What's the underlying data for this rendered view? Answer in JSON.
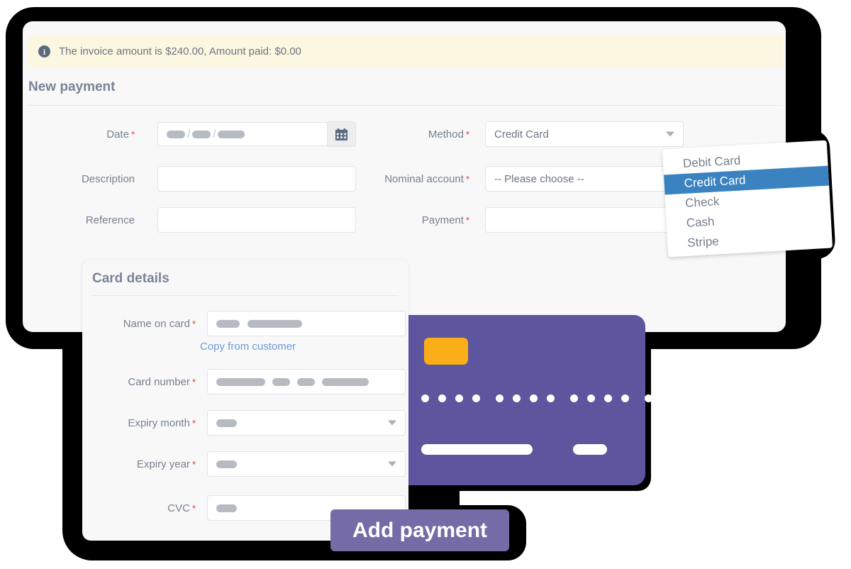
{
  "alert": {
    "icon": "info-icon",
    "text": "The invoice amount is $240.00, Amount paid: $0.00"
  },
  "main_form": {
    "title": "New payment",
    "left_fields": [
      {
        "label": "Date",
        "required": true,
        "value_masked": true,
        "mask_pattern": "dd/mm/yyyy",
        "trailing_icon": "calendar-icon"
      },
      {
        "label": "Description",
        "required": false,
        "value": ""
      },
      {
        "label": "Reference",
        "required": false,
        "value": ""
      }
    ],
    "right_fields": [
      {
        "label": "Method",
        "required": true,
        "value": "Credit Card",
        "type": "select"
      },
      {
        "label": "Nominal account",
        "required": true,
        "value": "-- Please choose --",
        "type": "select"
      },
      {
        "label": "Payment",
        "required": true,
        "value": "",
        "type": "text"
      }
    ]
  },
  "method_dropdown": {
    "options": [
      {
        "label": "Debit Card",
        "selected": false
      },
      {
        "label": "Credit Card",
        "selected": true
      },
      {
        "label": "Check",
        "selected": false
      },
      {
        "label": "Cash",
        "selected": false
      },
      {
        "label": "Stripe",
        "selected": false
      }
    ],
    "highlight_color": "#3b83c0"
  },
  "card_details": {
    "title": "Card details",
    "copy_link": "Copy from customer",
    "fields": [
      {
        "label": "Name on card",
        "required": true,
        "masked": true,
        "type": "text"
      },
      {
        "label": "Card number",
        "required": true,
        "masked": true,
        "type": "text"
      },
      {
        "label": "Expiry month",
        "required": true,
        "masked": true,
        "type": "select"
      },
      {
        "label": "Expiry year",
        "required": true,
        "masked": true,
        "type": "select"
      },
      {
        "label": "CVC",
        "required": true,
        "masked": true,
        "type": "text"
      }
    ]
  },
  "card_art": {
    "card_color": "#5d559e",
    "chip_color": "#fbae17",
    "number_groups": 4,
    "digits_per_group": 4
  },
  "actions": {
    "submit_label": "Add payment",
    "submit_color": "#746ba7"
  }
}
